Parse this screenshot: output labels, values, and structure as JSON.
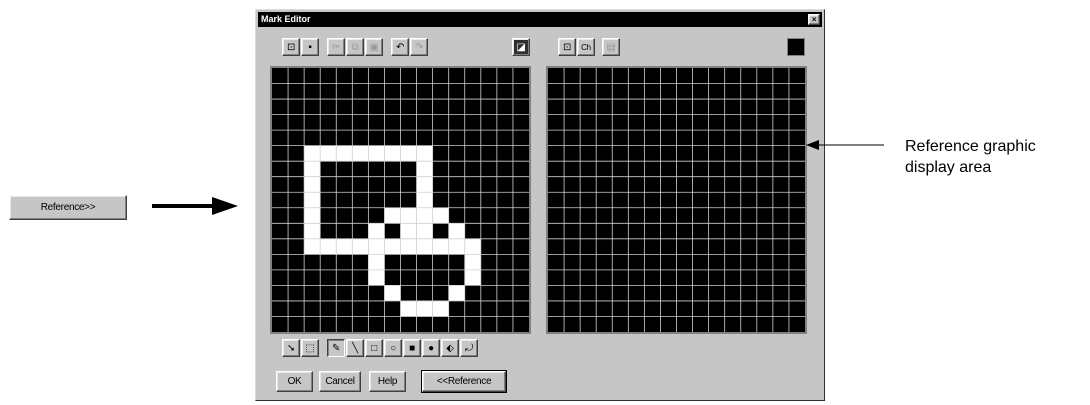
{
  "window": {
    "title": "Mark Editor",
    "close_glyph": "×"
  },
  "toolbar": {
    "buttons": [
      {
        "name": "open-icon",
        "glyph": "⊡",
        "enabled": true
      },
      {
        "name": "save-icon",
        "glyph": "▪",
        "enabled": true
      },
      {
        "name": "cut-icon",
        "glyph": "✂",
        "enabled": false
      },
      {
        "name": "copy-icon",
        "glyph": "⧉",
        "enabled": false
      },
      {
        "name": "paste-icon",
        "glyph": "▣",
        "enabled": false
      },
      {
        "name": "undo-icon",
        "glyph": "↶",
        "enabled": true
      },
      {
        "name": "redo-icon",
        "glyph": "↷",
        "enabled": false
      },
      {
        "name": "invert-icon",
        "glyph": "◪",
        "enabled": true
      }
    ],
    "ref_buttons": [
      {
        "name": "ref-open-icon",
        "glyph": "⊡",
        "enabled": true
      },
      {
        "name": "ref-ch-icon",
        "glyph": "Ch",
        "enabled": true
      },
      {
        "name": "ref-import-icon",
        "glyph": "▤",
        "enabled": false
      }
    ],
    "color_indicator": "#000000"
  },
  "tools": [
    {
      "name": "select-arrow-icon",
      "glyph": "➘"
    },
    {
      "name": "select-rect-icon",
      "glyph": "⬚"
    },
    {
      "name": "pencil-icon",
      "glyph": "✎"
    },
    {
      "name": "line-icon",
      "glyph": "╲"
    },
    {
      "name": "rectangle-icon",
      "glyph": "□"
    },
    {
      "name": "ellipse-icon",
      "glyph": "○"
    },
    {
      "name": "filled-rectangle-icon",
      "glyph": "■"
    },
    {
      "name": "filled-ellipse-icon",
      "glyph": "●"
    },
    {
      "name": "flip-icon",
      "glyph": "⬖"
    },
    {
      "name": "rotate-icon",
      "glyph": "⤾"
    }
  ],
  "dialog_buttons": {
    "ok": "OK",
    "cancel": "Cancel",
    "help": "Help",
    "reference": "<<Reference"
  },
  "outside": {
    "reference_button": "Reference>>",
    "annotation_line1": "Reference graphic",
    "annotation_line2": "display area"
  },
  "colors": {
    "grid_bg": "#000000",
    "grid_line": "#d0d0d0",
    "pixel_on": "#ffffff"
  },
  "editor_grid": {
    "columns": 16,
    "rows": 17,
    "on_pixels": [
      [
        2,
        5
      ],
      [
        3,
        5
      ],
      [
        4,
        5
      ],
      [
        5,
        5
      ],
      [
        6,
        5
      ],
      [
        7,
        5
      ],
      [
        8,
        5
      ],
      [
        9,
        5
      ],
      [
        2,
        6
      ],
      [
        9,
        6
      ],
      [
        2,
        7
      ],
      [
        9,
        7
      ],
      [
        2,
        8
      ],
      [
        9,
        8
      ],
      [
        2,
        9
      ],
      [
        7,
        9
      ],
      [
        8,
        9
      ],
      [
        9,
        9
      ],
      [
        10,
        9
      ],
      [
        2,
        10
      ],
      [
        6,
        10
      ],
      [
        8,
        10
      ],
      [
        9,
        10
      ],
      [
        11,
        10
      ],
      [
        2,
        11
      ],
      [
        3,
        11
      ],
      [
        4,
        11
      ],
      [
        5,
        11
      ],
      [
        6,
        11
      ],
      [
        7,
        11
      ],
      [
        8,
        11
      ],
      [
        9,
        11
      ],
      [
        10,
        11
      ],
      [
        11,
        11
      ],
      [
        12,
        11
      ],
      [
        6,
        12
      ],
      [
        12,
        12
      ],
      [
        6,
        13
      ],
      [
        12,
        13
      ],
      [
        7,
        14
      ],
      [
        11,
        14
      ],
      [
        8,
        15
      ],
      [
        9,
        15
      ],
      [
        10,
        15
      ]
    ]
  },
  "reference_grid": {
    "columns": 16,
    "rows": 17,
    "on_pixels": []
  }
}
